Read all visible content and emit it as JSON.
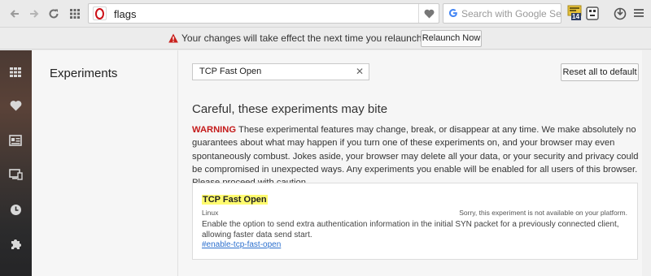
{
  "toolbar": {
    "address": "flags",
    "search_placeholder": "Search with Google Se...",
    "badge_count": "14"
  },
  "infobar": {
    "message": "Your changes will take effect the next time you relaunch Opera.",
    "button": "Relaunch Now"
  },
  "sidebar": {
    "items": [
      "speed-dial",
      "bookmarks",
      "news",
      "tabs",
      "history",
      "extensions"
    ]
  },
  "panel": {
    "title": "Experiments"
  },
  "main": {
    "filter_value": "TCP Fast Open",
    "reset_button": "Reset all to default",
    "heading": "Careful, these experiments may bite",
    "warning_label": "WARNING",
    "warning_text": " These experimental features may change, break, or disappear at any time. We make absolutely no guarantees about what may happen if you turn one of these experiments on, and your browser may even spontaneously combust. Jokes aside, your browser may delete all your data, or your security and privacy could be compromised in unexpected ways. Any experiments you enable will be enabled for all users of this browser. Please proceed with caution."
  },
  "experiment": {
    "title": "TCP Fast Open",
    "platform": "Linux",
    "status": "Sorry, this experiment is not available on your platform.",
    "description": "Enable the option to send extra authentication information in the initial SYN packet for a previously connected client, allowing faster data send start.",
    "link": "#enable-tcp-fast-open"
  },
  "colors": {
    "warning": "#c41a1a",
    "highlight": "#fffb6f",
    "link": "#2b6fce",
    "opera_red": "#cc0f16"
  }
}
